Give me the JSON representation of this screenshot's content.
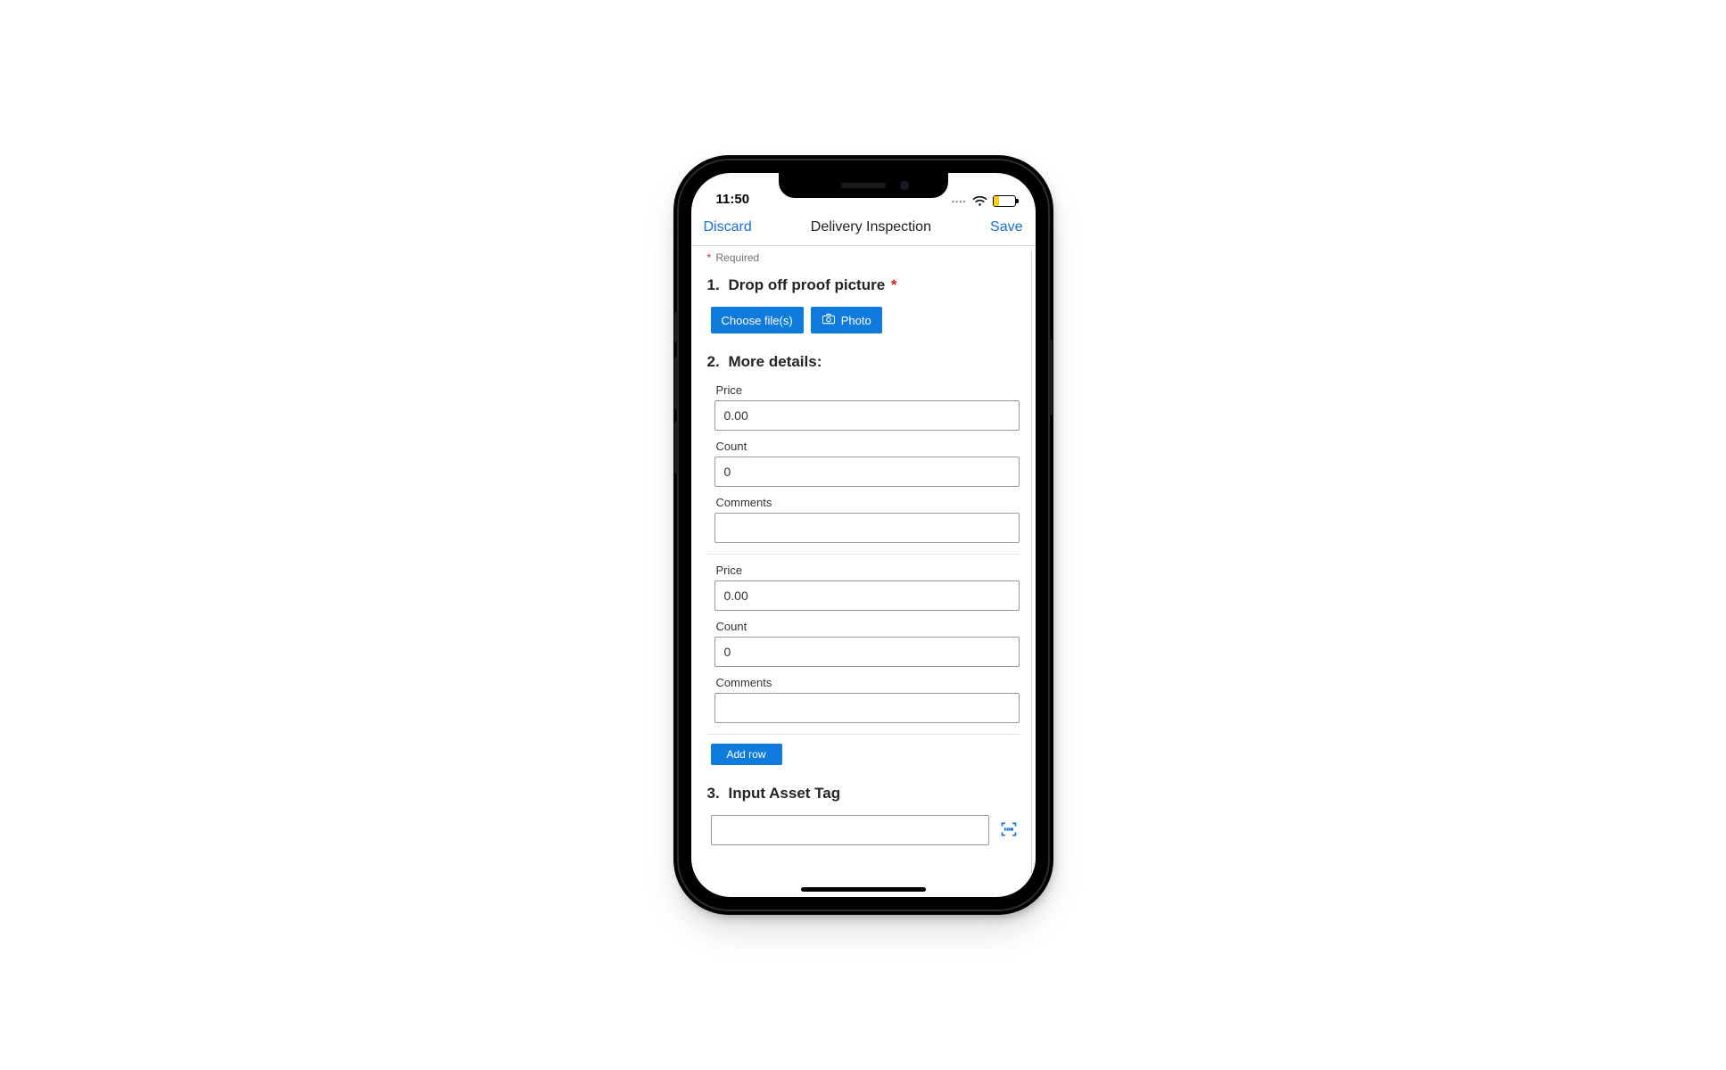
{
  "status": {
    "time": "11:50"
  },
  "nav": {
    "discard": "Discard",
    "title": "Delivery Inspection",
    "save": "Save"
  },
  "required_note": {
    "asterisk": "*",
    "text": "Required"
  },
  "q1": {
    "num": "1.",
    "title": "Drop off proof picture",
    "asterisk": "*",
    "choose": "Choose file(s)",
    "photo": "Photo"
  },
  "q2": {
    "num": "2.",
    "title": "More details:",
    "labels": {
      "price": "Price",
      "count": "Count",
      "comments": "Comments"
    },
    "rows": [
      {
        "price": "0.00",
        "count": "0",
        "comments": ""
      },
      {
        "price": "0.00",
        "count": "0",
        "comments": ""
      }
    ],
    "add_row": "Add row"
  },
  "q3": {
    "num": "3.",
    "title": "Input Asset Tag",
    "value": ""
  }
}
